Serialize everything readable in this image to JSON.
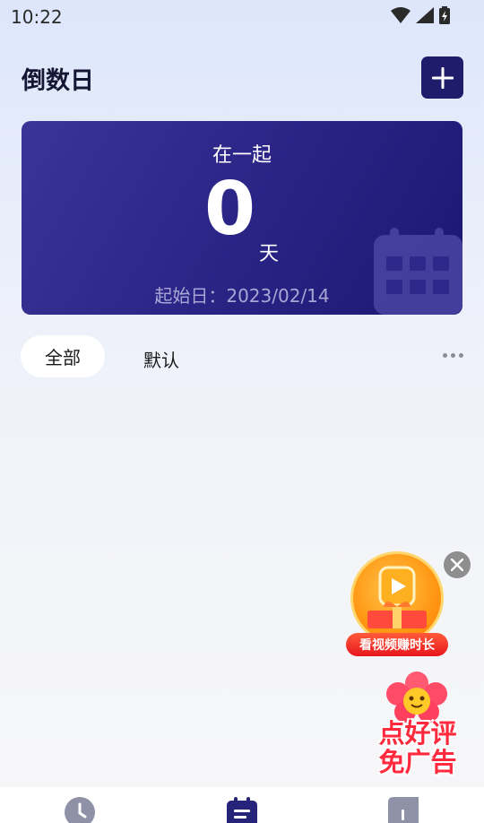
{
  "status_bar": {
    "time": "10:22"
  },
  "header": {
    "title": "倒数日"
  },
  "card": {
    "title": "在一起",
    "days": "0",
    "unit": "天",
    "start_date": "起始日：2023/02/14"
  },
  "tabs": [
    {
      "label": "全部",
      "selected": true
    },
    {
      "label": "默认",
      "selected": false
    }
  ],
  "ads": {
    "video_label": "看视频赚时长",
    "rate_label_line1": "点好评",
    "rate_label_line2": "免广告"
  },
  "colors": {
    "accent": "#1f1d6b",
    "card_start": "#3b3497",
    "card_end": "#1c1672",
    "ad_red": "#e8161e"
  },
  "icons": {
    "add": "plus-icon",
    "more": "more-horizontal-icon",
    "close": "close-icon",
    "nav": [
      "clock-icon",
      "calendar-list-icon",
      "note-icon"
    ]
  }
}
